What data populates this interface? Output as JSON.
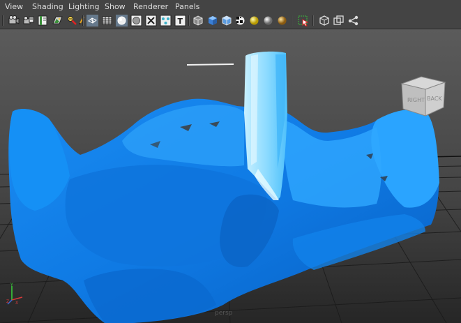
{
  "menu": [
    "View",
    "Shading",
    "Lighting",
    "Show",
    "Renderer",
    "Panels"
  ],
  "toolbar": {
    "icons": [
      "camera-select-icon",
      "camera-attributes-icon",
      "bookmark-icon",
      "image-plane-icon",
      "2d-pan-zoom-icon",
      "grease-pencil-icon",
      "wireframe-icon",
      "grid-toggle-icon",
      "smooth-shade-icon",
      "default-material-icon",
      "xray-icon",
      "xray-joints-icon",
      "textured-icon",
      "wireframe-on-shaded-icon",
      "smooth-shade-all-icon",
      "flat-shade-icon",
      "checker-icon",
      "use-all-lights-icon",
      "shadows-icon",
      "ambient-occlusion-icon",
      "isolate-select-icon",
      "camera-gate-icon",
      "resolution-gate-icon",
      "safe-area-icon"
    ]
  },
  "viewcube": {
    "right_label": "RIGHT",
    "back_label": "BACK"
  },
  "camera_label": "persp",
  "colors": {
    "ui_background": "#444444",
    "viewport_top": "#5a5a5a",
    "viewport_bottom": "#2a2a2a",
    "water_deep": "#0a6fd8",
    "water_mid": "#1c8ef0",
    "water_light": "#5cc4ff",
    "waterfall": "#a8e6ff"
  }
}
